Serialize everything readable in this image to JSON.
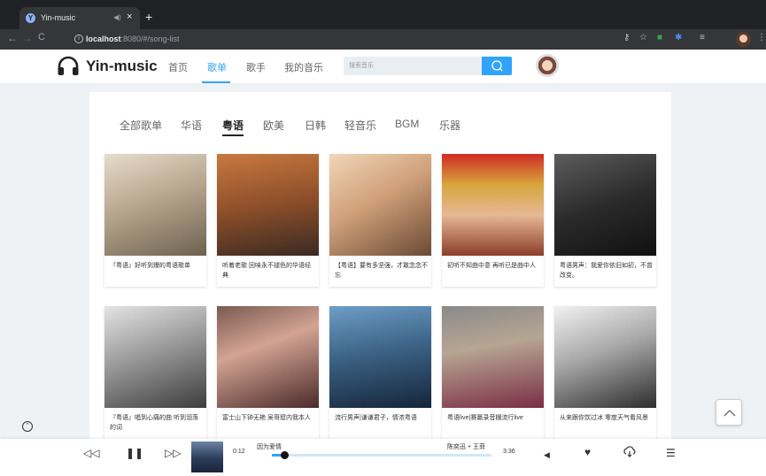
{
  "browser": {
    "tab_title": "Yin-music",
    "url_host": "localhost",
    "url_rest": ":8080/#/song-list"
  },
  "header": {
    "logo_text": "Yin-music",
    "nav": [
      {
        "label": "首页",
        "active": false
      },
      {
        "label": "歌单",
        "active": true
      },
      {
        "label": "歌手",
        "active": false
      },
      {
        "label": "我的音乐",
        "active": false
      }
    ],
    "search_placeholder": "搜索音乐"
  },
  "categories": [
    {
      "label": "全部歌单",
      "active": false
    },
    {
      "label": "华语",
      "active": false
    },
    {
      "label": "粤语",
      "active": true
    },
    {
      "label": "欧美",
      "active": false
    },
    {
      "label": "日韩",
      "active": false
    },
    {
      "label": "轻音乐",
      "active": false
    },
    {
      "label": "BGM",
      "active": false
    },
    {
      "label": "乐器",
      "active": false
    }
  ],
  "playlists": [
    {
      "title": "『粤语』好听到爆的粤语歌单"
    },
    {
      "title": "听着老歌 回味永不褪色的华语经典"
    },
    {
      "title": "【粤语】要有多坚强，才敢念念不忘"
    },
    {
      "title": "初听不知曲中意 再听已是曲中人"
    },
    {
      "title": "粤语男声：我爱你依旧如初，不曾改变。"
    },
    {
      "title": "『粤语』唱到心痛的曲 听到泪落的词"
    },
    {
      "title": "富士山下钟无艳 吴哥窟内我本人"
    },
    {
      "title": "流行男声|谦谦君子，情浓粤语"
    },
    {
      "title": "粤语live|赛赢录音棚流行live"
    },
    {
      "title": "从来跟你饮过冰 零度天气看风景"
    }
  ],
  "player": {
    "current_time": "0:12",
    "song_name": "因为爱情",
    "artist": "陈奕迅 + 王菲",
    "duration": "3:36",
    "progress": 0.056
  }
}
